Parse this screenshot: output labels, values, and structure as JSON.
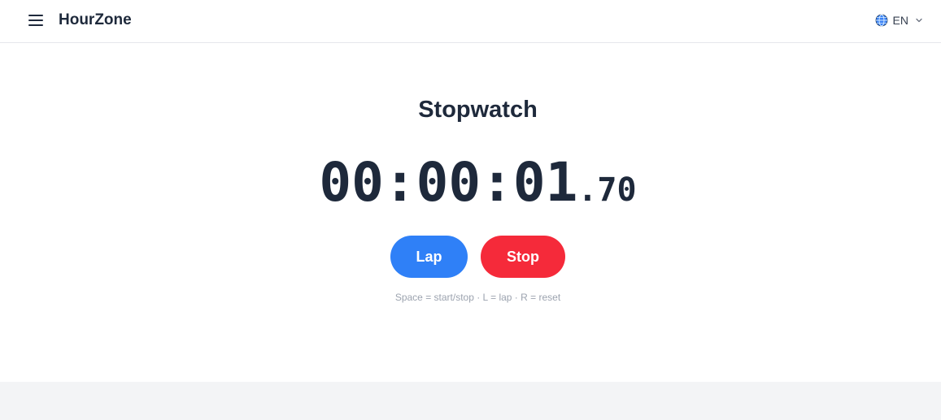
{
  "header": {
    "brand": "HourZone",
    "language": "EN",
    "menu_icon": "hamburger-menu-icon",
    "globe_icon": "globe-icon",
    "chevron_icon": "chevron-down-icon"
  },
  "stopwatch": {
    "title": "Stopwatch",
    "time_main": "00:00:01",
    "time_fraction": ".70",
    "lap_label": "Lap",
    "stop_label": "Stop",
    "shortcuts_hint": "Space = start/stop · L = lap · R = reset"
  },
  "colors": {
    "lap_button": "#2f80f7",
    "stop_button": "#f52a3a",
    "text_primary": "#1e293b",
    "hint_text": "#9ca3af",
    "footer_band": "#f3f4f6"
  }
}
